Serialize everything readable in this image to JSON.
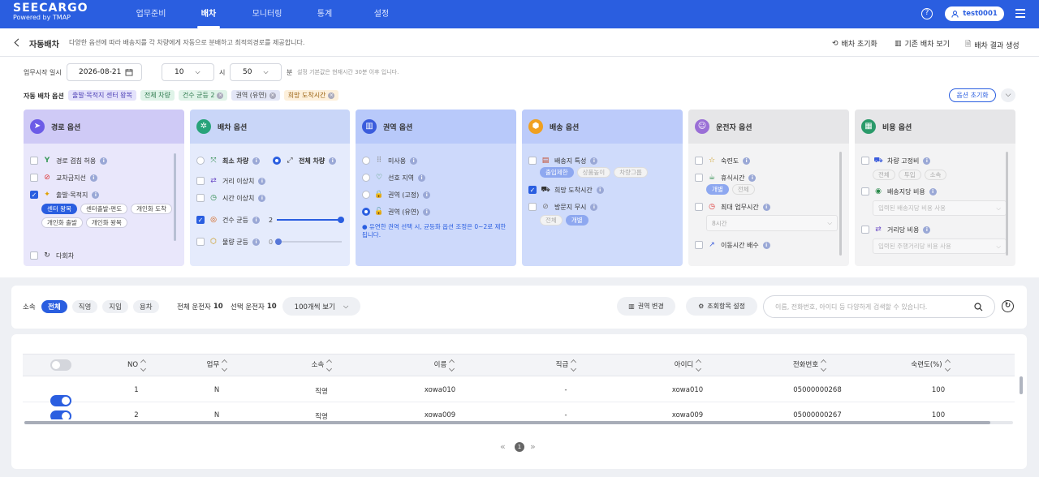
{
  "header": {
    "logo_main": "SEECARGO",
    "logo_sub": "Powered by TMAP",
    "nav": [
      "업무준비",
      "배차",
      "모니터링",
      "통계",
      "설정"
    ],
    "active_nav": "배차",
    "help_icon": "?",
    "user": "test0001"
  },
  "subheader": {
    "title": "자동배차",
    "description": "다양한 옵션에 따라 배송지를 각 차량에게 자동으로 분배하고 최적의경로를 제공합니다.",
    "actions": [
      "배차 초기화",
      "기존 배차 보기",
      "배차 결과 생성"
    ]
  },
  "start": {
    "label": "업무시작 일시",
    "date": "2026-08-21",
    "hour": "10",
    "hour_unit": "시",
    "minute": "50",
    "minute_unit": "분",
    "hint": "설정 기본값은 현재시간 30분 이후 입니다."
  },
  "auto_options": {
    "label": "자동 배차 옵션",
    "chips": [
      "출발·목적지 센터 왕복",
      "전체 차량",
      "건수 균등 2",
      "권역 (유연)",
      "희망 도착시간"
    ],
    "reset": "옵션 초기화"
  },
  "panels": {
    "route": {
      "title": "경로 옵션",
      "items": [
        "경로 겹침 허용",
        "교차금지선",
        "출발·목적지",
        "다회차"
      ],
      "subs": [
        "센터 왕복",
        "센터출발-편도",
        "개인화 도착",
        "개인화 출발",
        "개인화 왕복"
      ]
    },
    "dispatch": {
      "title": "배차 옵션",
      "items": [
        "최소 차량",
        "전체 차량",
        "거리 이상치",
        "시간 이상치",
        "건수 균등",
        "물량 균등"
      ],
      "count_value": "2",
      "volume_value": "0"
    },
    "zone": {
      "title": "권역 옵션",
      "items": [
        "미사용",
        "선호 지역",
        "권역 (고정)",
        "권역 (유연)"
      ],
      "note": "● 유연한 권역 선택 시, 균등화 옵션 조정은 0~2로 제한됩니다."
    },
    "delivery": {
      "title": "배송 옵션",
      "items": [
        "배송지 특성",
        "희망 도착시간",
        "방문지 무시"
      ],
      "subs1": [
        "출입제한",
        "상품높이",
        "차량그룹"
      ],
      "subs2": [
        "전체",
        "개별"
      ]
    },
    "driver": {
      "title": "운전자 옵션",
      "items": [
        "숙련도",
        "휴식시간",
        "최대 업무시간",
        "이동시간 배수"
      ],
      "subs": [
        "개별",
        "전체"
      ],
      "select": "8시간"
    },
    "cost": {
      "title": "비용 옵션",
      "items": [
        "차량 고정비",
        "배송지당 비용",
        "거리당 비용"
      ],
      "subs": [
        "전체",
        "투입",
        "소속"
      ],
      "ph1": "입력된 배송지당 비용 사용",
      "ph2": "입력된 주행거리당 비용 사용"
    }
  },
  "filter": {
    "label": "소속",
    "tabs": [
      "전체",
      "직영",
      "지입",
      "용차"
    ],
    "total_label": "전체 운전자",
    "total": "10",
    "selected_label": "선택 운전자",
    "selected": "10",
    "page_size": "100개씩 보기",
    "zone_btn": "권역 변경",
    "columns_btn": "조회항목 설정",
    "search_placeholder": "이름, 전화번호, 아이디 등 다양하게 검색할 수 있습니다."
  },
  "table": {
    "columns": [
      "NO",
      "업무",
      "소속",
      "이름",
      "직급",
      "아이디",
      "전화번호",
      "숙련도(%)"
    ],
    "rows": [
      [
        "1",
        "N",
        "직영",
        "xowa010",
        "-",
        "xowa010",
        "05000000268",
        "100"
      ],
      [
        "2",
        "N",
        "직영",
        "xowa009",
        "-",
        "xowa009",
        "05000000267",
        "100"
      ]
    ]
  },
  "pagination": {
    "current": "1",
    "prev": "«",
    "next": "»"
  },
  "colors": {
    "primary": "#2a5ee0"
  }
}
